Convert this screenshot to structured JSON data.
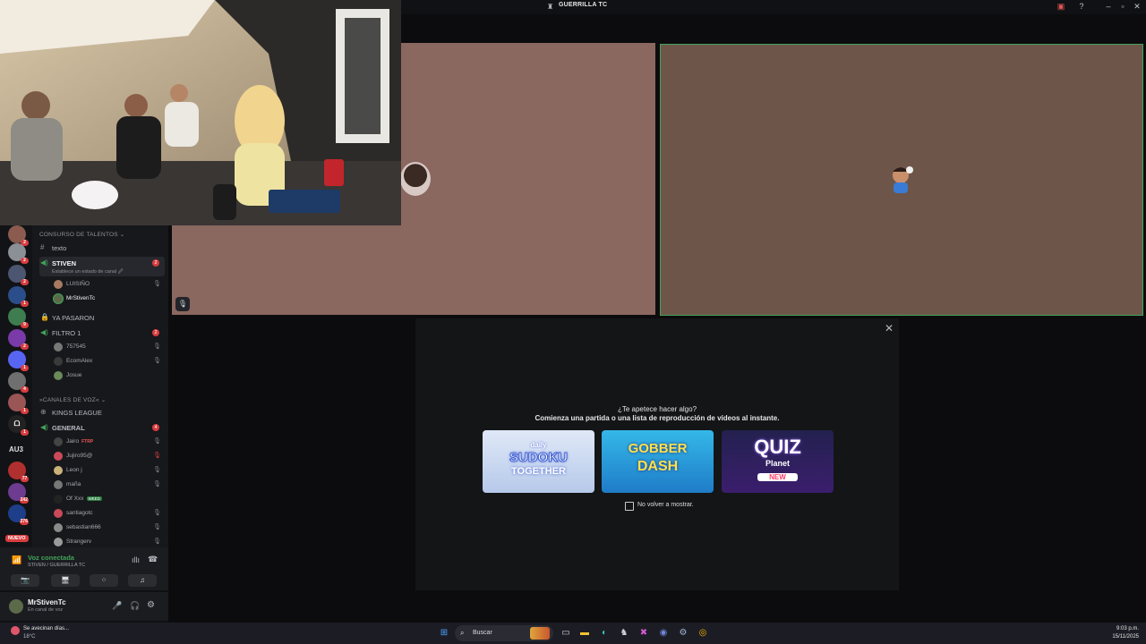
{
  "window": {
    "title": "GUERRILLA TC"
  },
  "server_badges": [
    "2",
    "2",
    "2",
    "1",
    "9",
    "2",
    "1",
    "4",
    "1",
    "1",
    "77",
    "242",
    "276"
  ],
  "server_labels": {
    "au3": "AU3",
    "nuevo": "NUEVO"
  },
  "channels": {
    "category_top": "CONSURSO DE TALENTOS ⌄",
    "text_channel": "texto",
    "stiven": {
      "label": "STIVEN",
      "count": "2",
      "status": "Establece un estado de canal 🖉"
    },
    "stiven_users": [
      "LUISIÑO",
      "MrStivenTc"
    ],
    "ya_pasaron": "YA PASARON",
    "filtro": {
      "label": "FILTRO 1",
      "count": "2"
    },
    "filtro_users": [
      "757545",
      "EcomAlex",
      "Josue"
    ],
    "category_voice": "»CANALES DE VOZ« ⌄",
    "kings": "KINGS LEAGUE",
    "general": {
      "label": "GENERAL",
      "count": "4"
    },
    "general_users": [
      {
        "name": "Jairo",
        "tag": "FTRP"
      },
      {
        "name": "Jujiro95@"
      },
      {
        "name": "Leon j"
      },
      {
        "name": "maña"
      },
      {
        "name": "Of Xxx",
        "tag2": "WEED"
      },
      {
        "name": "santiagotc"
      },
      {
        "name": "sebastian666"
      },
      {
        "name": "Strangerv"
      }
    ]
  },
  "voice": {
    "status": "Voz conectada",
    "location": "STIVEN / GUERRILLA TC"
  },
  "user": {
    "name": "MrStivenTc",
    "status": "En canal de voz"
  },
  "activity": {
    "title": "¿Te apetece hacer algo?",
    "subtitle": "Comienza una partida o una lista de reproducción de vídeos al instante.",
    "cards": [
      {
        "line1": "daily",
        "line2": "SUDOKU",
        "line3": "TOGETHER"
      },
      {
        "line1": "GOBBER",
        "line2": "DASH",
        "line3": ""
      },
      {
        "line1": "QUIZ",
        "line2": "Planet",
        "line3": "NEW"
      }
    ],
    "checkbox_label": "No volver a mostrar."
  },
  "taskbar": {
    "weather_title": "Se avecinan días...",
    "weather_temp": "18°C",
    "search_placeholder": "Buscar",
    "time": "9:03 p.m.",
    "date": "15/11/2025"
  },
  "colors": {
    "accent": "#43a25a",
    "badge": "#d83c3e",
    "tile1": "#8a675f",
    "tile2": "#6d5649"
  }
}
